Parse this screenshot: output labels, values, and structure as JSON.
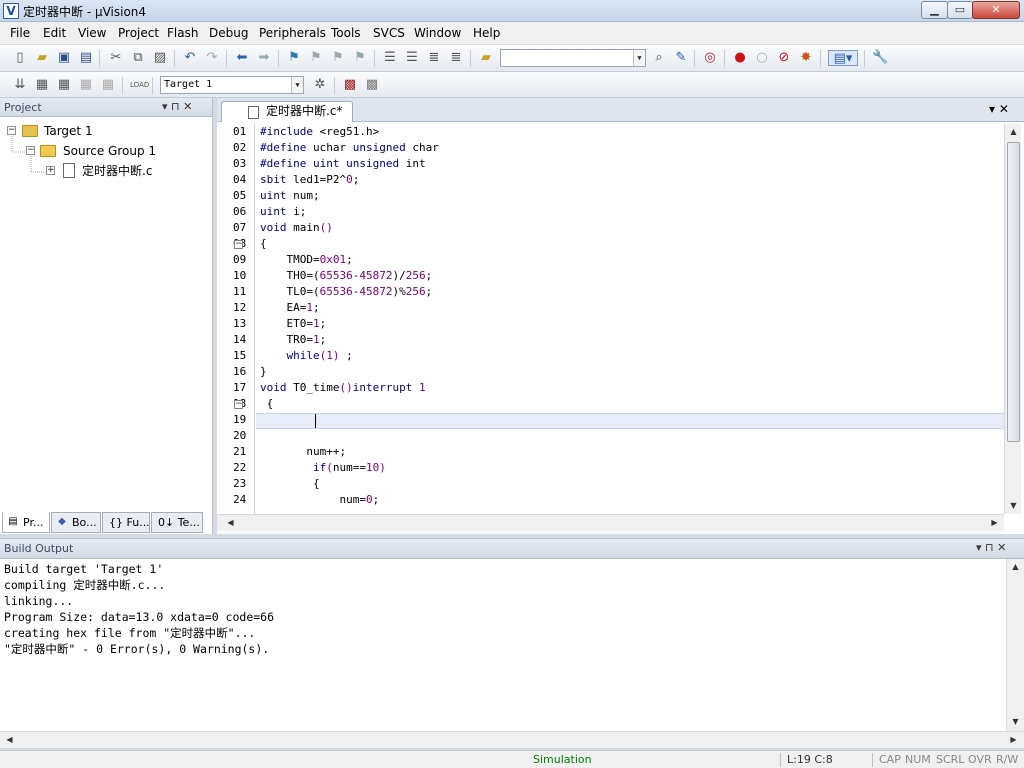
{
  "window": {
    "title": "定时器中断 - µVision4",
    "app_icon_glyph": "V",
    "min_glyph": "▁",
    "max_glyph": "▭",
    "close_glyph": "✕"
  },
  "menu": [
    "File",
    "Edit",
    "View",
    "Project",
    "Flash",
    "Debug",
    "Peripherals",
    "Tools",
    "SVCS",
    "Window",
    "Help"
  ],
  "toolbar": {
    "find_value": "",
    "target_select": "Target 1",
    "combo_arrow": "▼"
  },
  "project_pane": {
    "title": "Project",
    "pin_glyph": "▾ ⊓ ✕",
    "tree": {
      "target": "Target 1",
      "group": "Source Group 1",
      "file": "定时器中断.c"
    },
    "tabs": [
      {
        "label": "Pr...",
        "icon": "project-icon"
      },
      {
        "label": "Bo...",
        "icon": "books-icon"
      },
      {
        "label": "{} Fu...",
        "icon": "functions-icon"
      },
      {
        "label": "0↓ Te...",
        "icon": "templates-icon"
      }
    ]
  },
  "editor": {
    "tab_label": "定时器中断.c*",
    "tab_controls": "▾  ✕",
    "cursor_line": 19,
    "lines": [
      {
        "no": "01",
        "text": "#include <reg51.h>",
        "kind": "pp"
      },
      {
        "no": "02",
        "text": "#define uchar unsigned char",
        "kind": "pp"
      },
      {
        "no": "03",
        "text": "#define uint unsigned int",
        "kind": "pp"
      },
      {
        "no": "04",
        "text": "sbit led1=P2^0;",
        "kind": "plain"
      },
      {
        "no": "05",
        "text": "uint num;",
        "kind": "plain"
      },
      {
        "no": "06",
        "text": "uint i;",
        "kind": "plain"
      },
      {
        "no": "07",
        "text": "void main()",
        "kind": "plain"
      },
      {
        "no": "08",
        "text": "{",
        "kind": "fold"
      },
      {
        "no": "09",
        "text": "    TMOD=0x01;",
        "kind": "num"
      },
      {
        "no": "10",
        "text": "    TH0=(65536-45872)/256;",
        "kind": "num"
      },
      {
        "no": "11",
        "text": "    TL0=(65536-45872)%256;",
        "kind": "num"
      },
      {
        "no": "12",
        "text": "    EA=1;",
        "kind": "num"
      },
      {
        "no": "13",
        "text": "    ET0=1;",
        "kind": "num"
      },
      {
        "no": "14",
        "text": "    TR0=1;",
        "kind": "num"
      },
      {
        "no": "15",
        "text": "    while(1) ;",
        "kind": "num"
      },
      {
        "no": "16",
        "text": "}",
        "kind": "plain"
      },
      {
        "no": "17",
        "text": "void T0_time()interrupt 1",
        "kind": "num"
      },
      {
        "no": "18",
        "text": " {",
        "kind": "fold"
      },
      {
        "no": "19",
        "text": "",
        "kind": "current"
      },
      {
        "no": "20",
        "text": "",
        "kind": "plain"
      },
      {
        "no": "21",
        "text": "       num++;",
        "kind": "plain"
      },
      {
        "no": "22",
        "text": "        if(num==10)",
        "kind": "num"
      },
      {
        "no": "23",
        "text": "        {",
        "kind": "plain"
      },
      {
        "no": "24",
        "text": "            num=0;",
        "kind": "num"
      }
    ]
  },
  "build_output": {
    "title": "Build Output",
    "controls": "▾ ⊓ ✕",
    "lines": [
      "Build target 'Target 1'",
      "compiling 定时器中断.c...",
      "linking...",
      "Program Size: data=13.0 xdata=0 code=66",
      "creating hex file from \"定时器中断\"...",
      "\"定时器中断\" - 0 Error(s), 0 Warning(s)."
    ]
  },
  "statusbar": {
    "mode": "Simulation",
    "position": "L:19 C:8",
    "cap": "CAP",
    "num": "NUM",
    "scrl": "SCRL",
    "ovr": "OVR",
    "rw": "R/W"
  },
  "colors": {
    "keyword": "#000080",
    "number": "#800080",
    "mode_text": "#008000"
  }
}
